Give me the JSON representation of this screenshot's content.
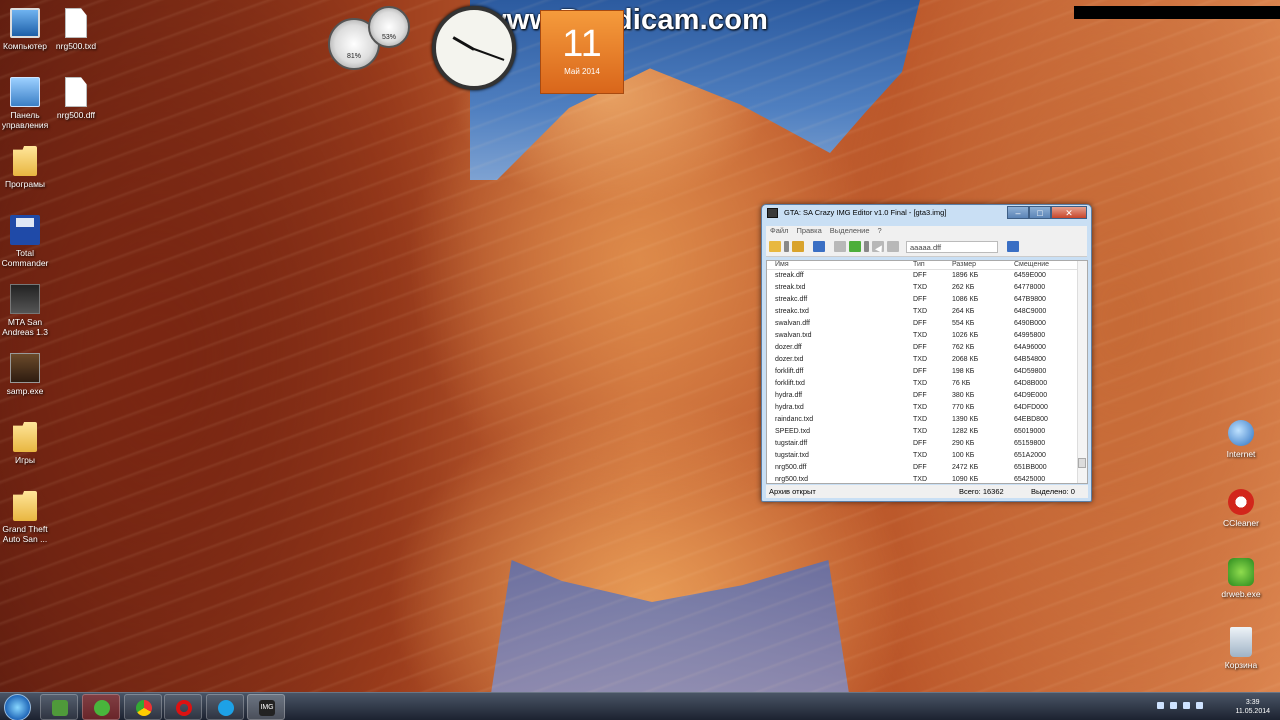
{
  "watermark": "www.Bandicam.com",
  "desktop_icons_left": [
    {
      "label": "Компьютер",
      "icon": "computer-icon"
    },
    {
      "label": "nrg500.txd",
      "icon": "file-icon"
    },
    {
      "label": "Панель управления",
      "icon": "control-panel-icon"
    },
    {
      "label": "nrg500.dff",
      "icon": "file-icon"
    },
    {
      "label": "Програмы",
      "icon": "folder-icon"
    },
    {
      "label": "Total Commander",
      "icon": "total-commander-icon"
    },
    {
      "label": "MTA San Andreas 1.3",
      "icon": "mta-icon"
    },
    {
      "label": "samp.exe",
      "icon": "samp-icon"
    },
    {
      "label": "Игры",
      "icon": "folder-icon"
    },
    {
      "label": "Grand Theft Auto San ...",
      "icon": "folder-icon"
    }
  ],
  "desktop_icons_right": [
    {
      "label": "Internet",
      "icon": "internet-icon"
    },
    {
      "label": "CCleaner",
      "icon": "ccleaner-icon"
    },
    {
      "label": "drweb.exe",
      "icon": "drweb-icon"
    },
    {
      "label": "Корзина",
      "icon": "recycle-bin-icon"
    }
  ],
  "gadgets": {
    "cpu_gauge": "81%",
    "ram_gauge": "53%",
    "calendar_day": "11",
    "calendar_month": "Май 2014"
  },
  "window": {
    "title": "GTA: SA Crazy IMG Editor v1.0 Final - [gta3.img]",
    "menu": [
      "Файл",
      "Правка",
      "Выделение",
      "?"
    ],
    "search_value": "aaaaa.dff",
    "columns": [
      "Имя",
      "Тип",
      "Размер",
      "Смещение"
    ],
    "rows": [
      [
        "streak.dff",
        "DFF",
        "1896 КБ",
        "6459E000"
      ],
      [
        "streak.txd",
        "TXD",
        "262 КБ",
        "64778000"
      ],
      [
        "streakc.dff",
        "DFF",
        "1086 КБ",
        "647B9800"
      ],
      [
        "streakc.txd",
        "TXD",
        "264 КБ",
        "648C9000"
      ],
      [
        "swalvan.dff",
        "DFF",
        "554 КБ",
        "6490B000"
      ],
      [
        "swalvan.txd",
        "TXD",
        "1026 КБ",
        "64995800"
      ],
      [
        "dozer.dff",
        "DFF",
        "762 КБ",
        "64A96000"
      ],
      [
        "dozer.txd",
        "TXD",
        "2068 КБ",
        "64B54800"
      ],
      [
        "forklift.dff",
        "DFF",
        "198 КБ",
        "64D59800"
      ],
      [
        "forklift.txd",
        "TXD",
        "76 КБ",
        "64D8B000"
      ],
      [
        "hydra.dff",
        "DFF",
        "380 КБ",
        "64D9E000"
      ],
      [
        "hydra.txd",
        "TXD",
        "770 КБ",
        "64DFD000"
      ],
      [
        "raindanc.txd",
        "TXD",
        "1390 КБ",
        "64EBD800"
      ],
      [
        "SPEED.txd",
        "TXD",
        "1282 КБ",
        "65019000"
      ],
      [
        "tugstair.dff",
        "DFF",
        "290 КБ",
        "65159800"
      ],
      [
        "tugstair.txd",
        "TXD",
        "100 КБ",
        "651A2000"
      ],
      [
        "nrg500.dff",
        "DFF",
        "2472 КБ",
        "651BB000"
      ],
      [
        "nrg500.txd",
        "TXD",
        "1090 КБ",
        "65425000"
      ]
    ],
    "status_left": "Архив открыт",
    "status_total": "Всего: 16362",
    "status_selected": "Выделено: 0"
  },
  "taskbar": {
    "time": "3:39",
    "date": "11.05.2014",
    "apps": [
      "explorer-icon",
      "utorrent-icon",
      "chrome-icon",
      "opera-icon",
      "skype-icon",
      "img-editor-icon"
    ],
    "img_label": "IMG"
  }
}
